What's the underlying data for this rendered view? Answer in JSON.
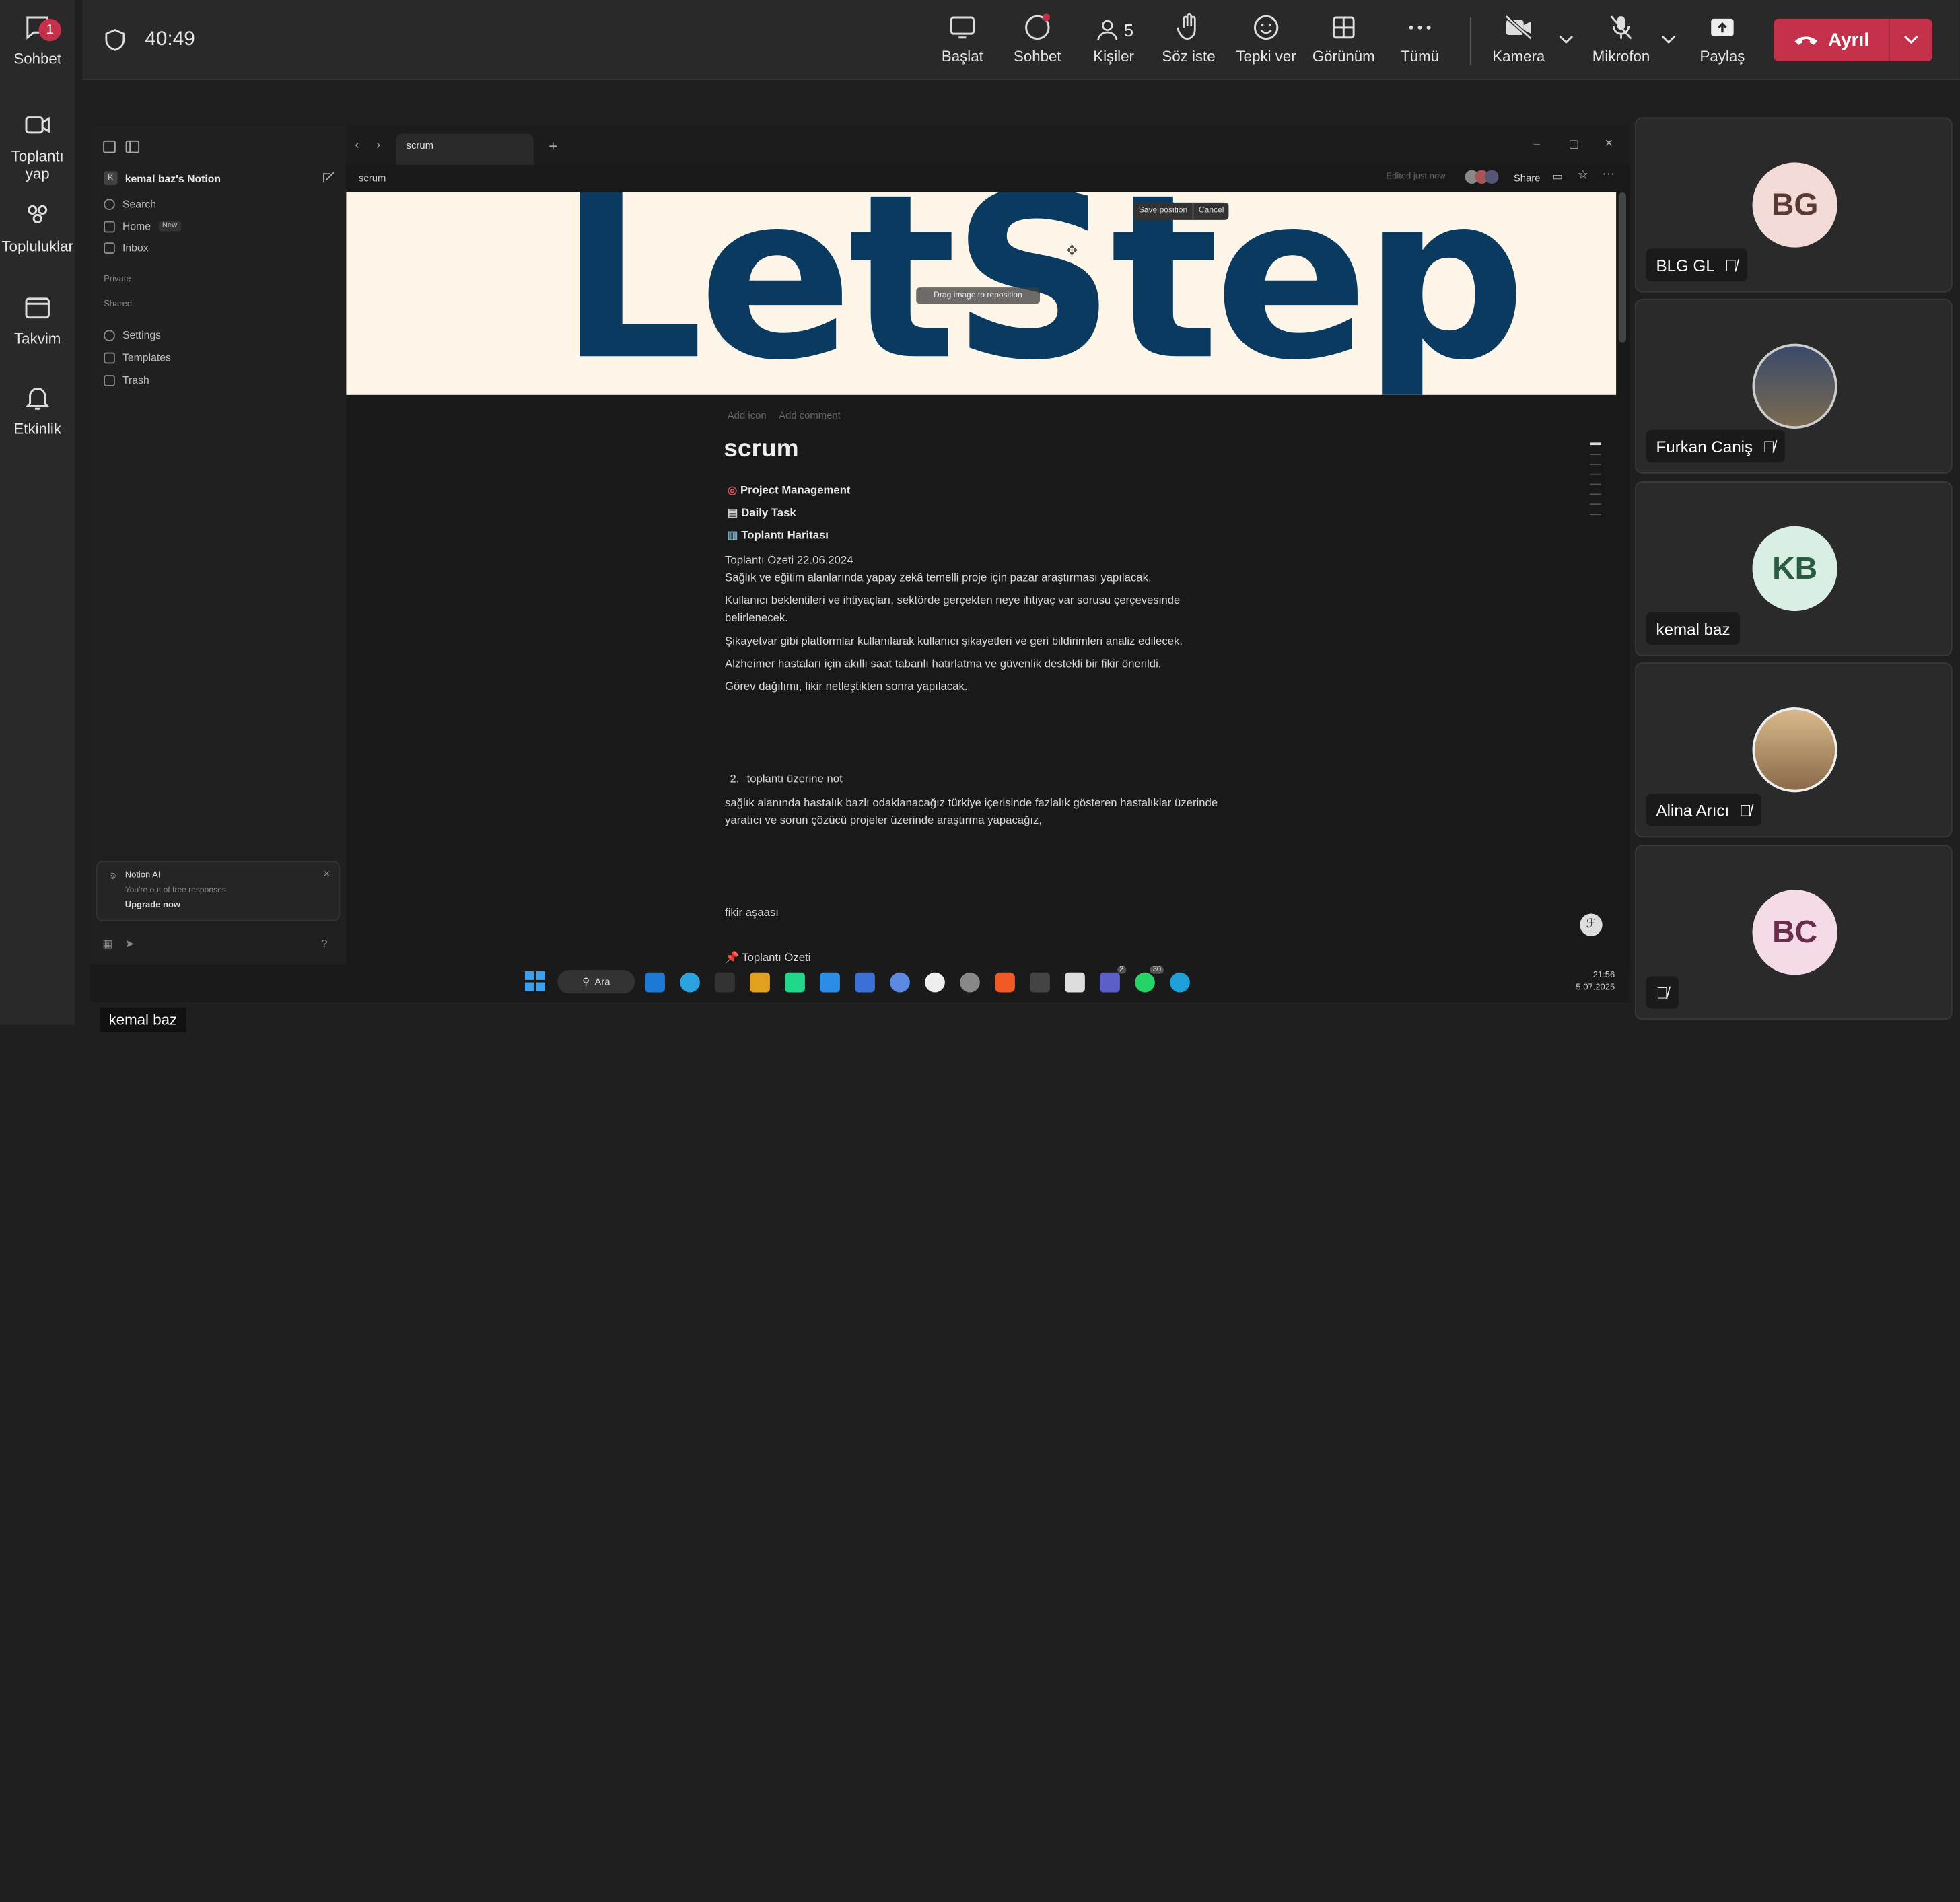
{
  "rail": {
    "items": [
      {
        "label": "Sohbet",
        "badge": "1"
      },
      {
        "label": "Toplantı yap"
      },
      {
        "label": "Topluluklar"
      },
      {
        "label": "Takvim"
      },
      {
        "label": "Etkinlik"
      }
    ]
  },
  "meeting": {
    "timer": "40:49",
    "people_count": "5"
  },
  "toolbar": {
    "start": "Başlat",
    "chat": "Sohbet",
    "people": "Kişiler",
    "raise": "Söz iste",
    "react": "Tepki ver",
    "view": "Görünüm",
    "more": "Tümü",
    "camera": "Kamera",
    "mic": "Mikrofon",
    "share": "Paylaş",
    "leave": "Ayrıl"
  },
  "notion": {
    "workspace": "kemal baz's Notion",
    "workspace_initial": "K",
    "search": "Search",
    "home": "Home",
    "home_badge": "New",
    "inbox": "Inbox",
    "private": "Private",
    "shared": "Shared",
    "settings": "Settings",
    "templates": "Templates",
    "trash": "Trash",
    "ai_title": "Notion AI",
    "ai_sub": "You're out of free responses",
    "ai_cta": "Upgrade now",
    "tab": "scrum",
    "breadcrumb": "scrum",
    "edited": "Edited just now",
    "share": "Share",
    "save_position": "Save position",
    "cancel": "Cancel",
    "drag_hint": "Drag image to reposition",
    "cover_text": "LetStep",
    "add_icon": "Add icon",
    "add_comment": "Add comment",
    "title": "scrum",
    "links": [
      "Project Management",
      "Daily Task",
      "Toplantı Haritası"
    ],
    "lines": [
      "Toplantı Özeti 22.06.2024",
      "Sağlık ve eğitim alanlarında yapay zekâ temelli proje için pazar araştırması yapılacak.",
      "Kullanıcı beklentileri ve ihtiyaçları, sektörde gerçekten neye ihtiyaç var sorusu çerçevesinde",
      "belirlenecek.",
      "Şikayetvar gibi platformlar kullanılarak kullanıcı şikayetleri ve geri bildirimleri analiz edilecek.",
      "Alzheimer hastaları için akıllı saat tabanlı hatırlatma ve güvenlik destekli bir fikir önerildi.",
      "Görev dağılımı, fikir netleştikten sonra yapılacak."
    ],
    "item2_num": "2.",
    "item2": "toplantı üzerine not",
    "note1": "sağlık alanında hastalık bazlı odaklanacağız türkiye içerisinde fazlalık gösteren hastalıklar üzerinde",
    "note2": "yaratıcı ve sorun çözücü projeler üzerinde araştırma yapacağız,",
    "idea": "fikir aşaası",
    "summary": "Toplantı Özeti"
  },
  "taskbar": {
    "search": "Ara",
    "time": "21:56",
    "date": "5.07.2025",
    "badge_teams": "2",
    "badge_whatsapp": "30"
  },
  "participants": [
    {
      "initials": "BG",
      "name": "BLG GL",
      "color": "#f3dcd8",
      "text": "#5a3a37"
    },
    {
      "initials": "",
      "name": "Furkan Caniş"
    },
    {
      "initials": "KB",
      "name": "kemal baz",
      "color": "#d9efe3",
      "text": "#2a5a40"
    },
    {
      "initials": "",
      "name": "Alina Arıcı"
    },
    {
      "initials": "BC",
      "name": "",
      "color": "#f5dbe7",
      "text": "#6a2e49"
    }
  ],
  "presenter_label": "kemal baz"
}
